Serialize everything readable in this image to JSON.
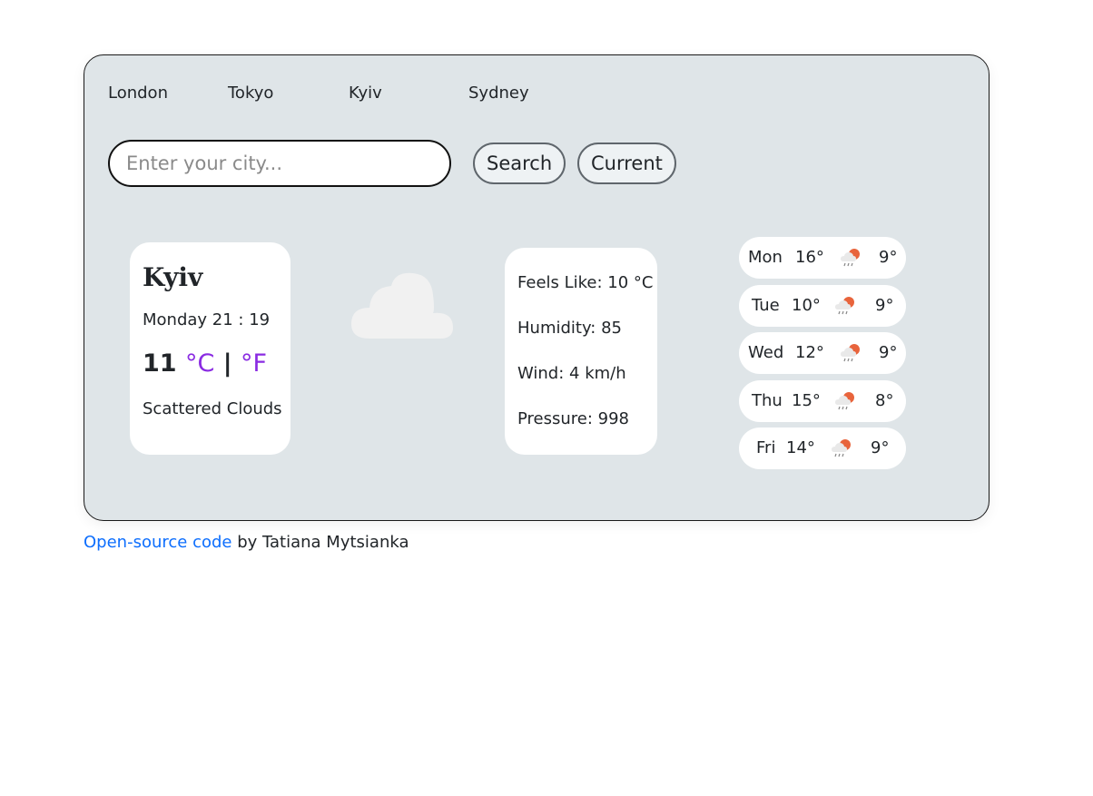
{
  "quick_cities": [
    "London",
    "Tokyo",
    "Kyiv",
    "Sydney"
  ],
  "search": {
    "placeholder": "Enter your city...",
    "value": ""
  },
  "buttons": {
    "search": "Search",
    "current": "Current"
  },
  "current": {
    "city": "Kyiv",
    "date": "Monday 21 : 19",
    "temperature": "11",
    "unit_c": "°C",
    "separator": "|",
    "unit_f": "°F",
    "description": "Scattered Clouds",
    "icon": "cloud-icon"
  },
  "details": {
    "feels_like": "Feels Like: 10 °C",
    "humidity": "Humidity: 85",
    "wind": "Wind: 4 km/h",
    "pressure": "Pressure: 998"
  },
  "forecast": [
    {
      "day": "Mon",
      "max": "16°",
      "min": "9°",
      "icon": "rain-sun-icon"
    },
    {
      "day": "Tue",
      "max": "10°",
      "min": "9°",
      "icon": "rain-sun-icon"
    },
    {
      "day": "Wed",
      "max": "12°",
      "min": "9°",
      "icon": "rain-sun-icon"
    },
    {
      "day": "Thu",
      "max": "15°",
      "min": "8°",
      "icon": "rain-sun-icon"
    },
    {
      "day": "Fri",
      "max": "14°",
      "min": "9°",
      "icon": "rain-sun-icon"
    }
  ],
  "footer": {
    "link_text": "Open-source code",
    "credit": " by Tatiana Mytsianka"
  },
  "colors": {
    "panel": "#dfe5e8",
    "unit_accent": "#8a2be2",
    "link": "#0d6efd"
  }
}
